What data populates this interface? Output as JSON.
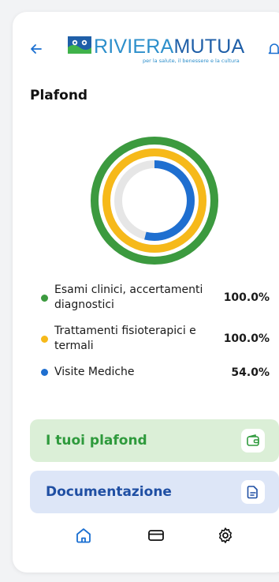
{
  "header": {
    "logo_riviera": "RIVIERA",
    "logo_mutua": "MUTUA",
    "logo_tagline": "per la salute, il benessere e la cultura"
  },
  "page_title": "Plafond",
  "plafond": {
    "items": [
      {
        "label": "Esami clinici, accertamenti diagnostici",
        "value": "100.0%",
        "percent": 100,
        "color": "#3c9a3f"
      },
      {
        "label": "Trattamenti fisioterapici e termali",
        "value": "100.0%",
        "percent": 100,
        "color": "#f6b91a"
      },
      {
        "label": "Visite Mediche",
        "value": "54.0%",
        "percent": 54,
        "color": "#1f6fd0"
      }
    ],
    "track_color": "#e6e6e6"
  },
  "buttons": {
    "plafond_label": "I tuoi plafond",
    "docs_label": "Documentazione"
  },
  "nav": {
    "items": [
      {
        "icon": "home-icon",
        "active": true
      },
      {
        "icon": "card-icon",
        "active": false
      },
      {
        "icon": "settings-icon",
        "active": false
      }
    ]
  }
}
